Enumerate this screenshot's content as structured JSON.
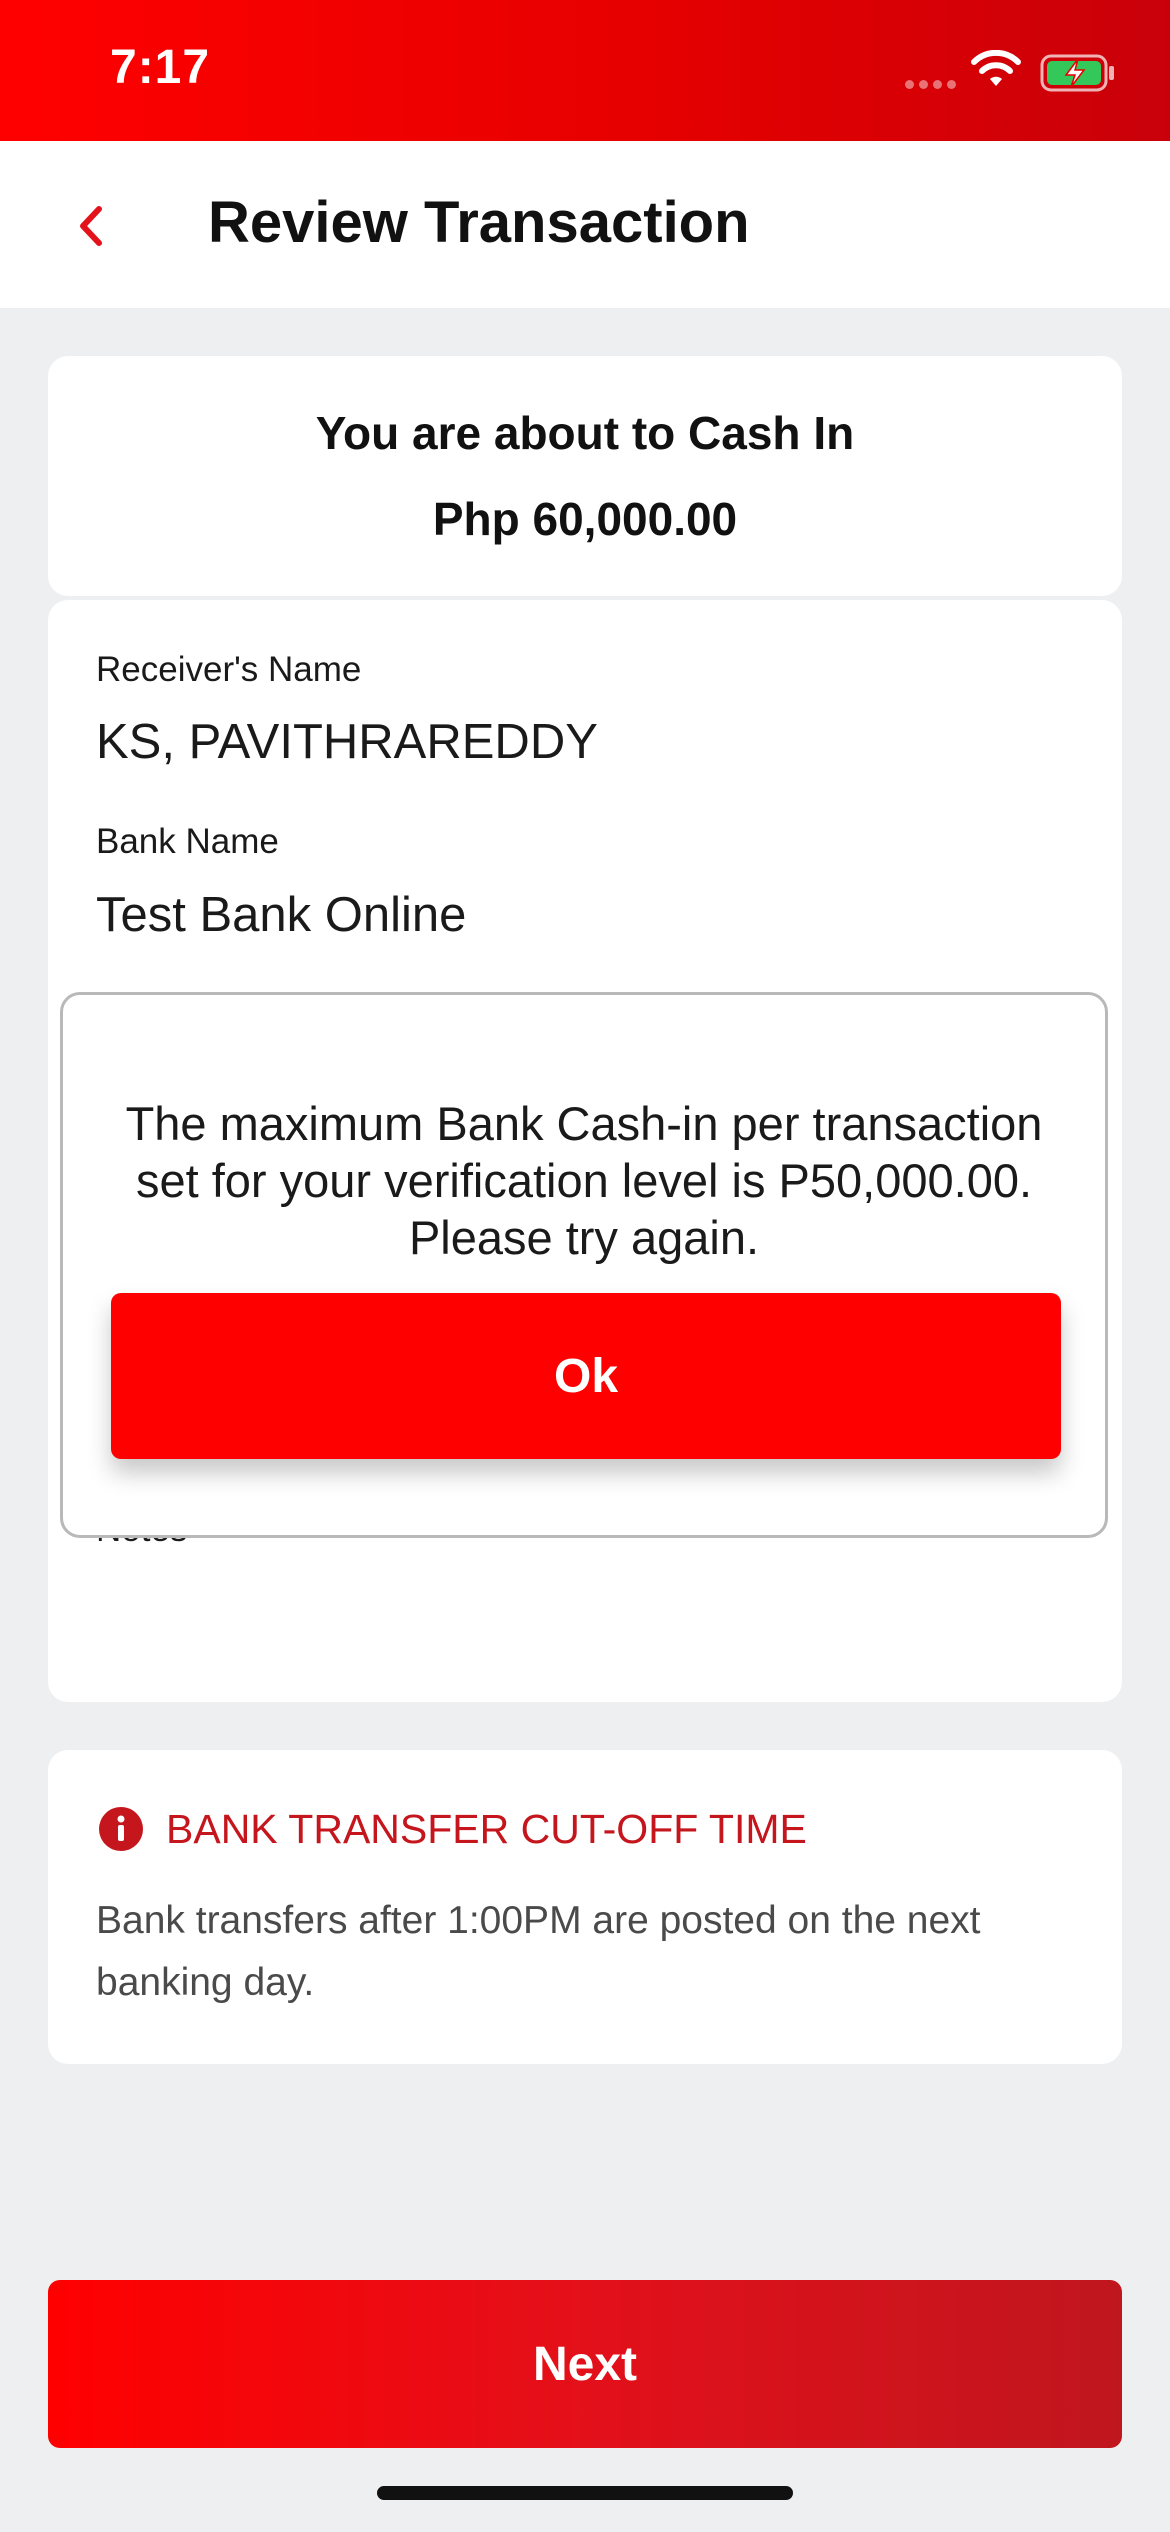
{
  "status_bar": {
    "time": "7:17",
    "icons": [
      "signal-dots-icon",
      "wifi-icon",
      "battery-charging-icon"
    ]
  },
  "header": {
    "back_icon": "chevron-left-icon",
    "title": "Review Transaction"
  },
  "summary": {
    "heading": "You are about to Cash In",
    "amount": "Php 60,000.00"
  },
  "details": {
    "receiver_label": "Receiver's Name",
    "receiver_value": "KS, PAVITHRAREDDY",
    "bank_label": "Bank Name",
    "bank_value": "Test Bank Online",
    "notes_label": "Notes"
  },
  "info": {
    "icon": "info-circle-icon",
    "title": "BANK TRANSFER CUT-OFF TIME",
    "text": "Bank transfers after 1:00PM are posted on the next banking day."
  },
  "dialog": {
    "message": "The maximum Bank Cash-in per transaction set for your verification level is P50,000.00. Please try again.",
    "ok_label": "Ok"
  },
  "footer": {
    "next_label": "Next"
  },
  "colors": {
    "brand_red": "#ff0000",
    "dark_red": "#c0161e",
    "background": "#eeeff1",
    "card": "#ffffff"
  }
}
